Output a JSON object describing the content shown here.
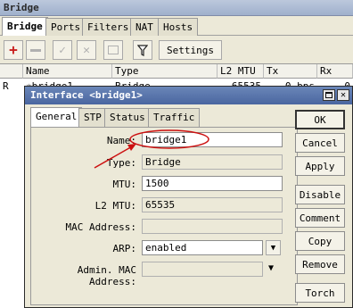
{
  "window": {
    "title": "Bridge"
  },
  "tabs": [
    "Bridge",
    "Ports",
    "Filters",
    "NAT",
    "Hosts"
  ],
  "toolbar": {
    "settings_label": "Settings"
  },
  "table": {
    "headers": [
      "Name",
      "Type",
      "L2 MTU",
      "Tx",
      "Rx"
    ],
    "row": {
      "flag": "R",
      "name": "✳bridge1",
      "type": "Bridge",
      "l2mtu": "65535",
      "tx": "0 bps",
      "rx": "0"
    }
  },
  "dialog": {
    "title": "Interface <bridge1>",
    "tabs": [
      "General",
      "STP",
      "Status",
      "Traffic"
    ],
    "fields": {
      "name": {
        "label": "Name:",
        "value": "bridge1"
      },
      "type": {
        "label": "Type:",
        "value": "Bridge"
      },
      "mtu": {
        "label": "MTU:",
        "value": "1500"
      },
      "l2mtu": {
        "label": "L2 MTU:",
        "value": "65535"
      },
      "mac": {
        "label": "MAC Address:",
        "value": ""
      },
      "arp": {
        "label": "ARP:",
        "value": "enabled"
      },
      "admin_mac": {
        "label": "Admin. MAC Address:",
        "value": ""
      }
    },
    "buttons": [
      "OK",
      "Cancel",
      "Apply",
      "Disable",
      "Comment",
      "Copy",
      "Remove",
      "Torch"
    ]
  },
  "annotation_color": "#cc1010"
}
